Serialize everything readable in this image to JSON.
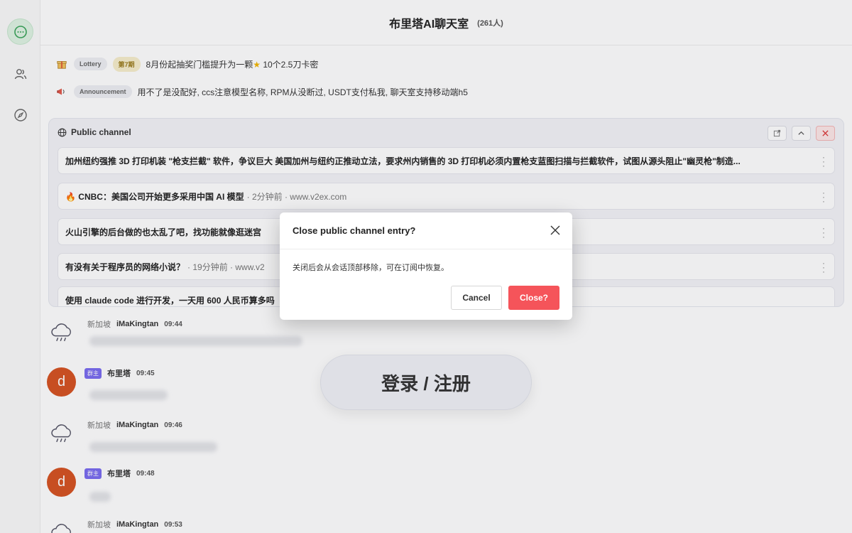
{
  "header": {
    "title": "布里塔AI聊天室",
    "member_count": "(261人)"
  },
  "sidebar": {
    "items": [
      {
        "icon": "chat-bubble-icon",
        "active": true
      },
      {
        "icon": "users-icon",
        "active": false
      },
      {
        "icon": "compass-icon",
        "active": false
      }
    ]
  },
  "notices": {
    "lottery": {
      "icon": "gift-icon",
      "tag": "Lottery",
      "period": "第7期",
      "text_before": "8月份起抽奖门槛提升为一颗",
      "text_after": "10个2.5刀卡密"
    },
    "announcement": {
      "icon": "megaphone-icon",
      "tag": "Announcement",
      "text": "用不了是没配好, ccs注意模型名称, RPM从没断过, USDT支付私我, 聊天室支持移动端h5"
    }
  },
  "public_channel": {
    "title": "Public channel",
    "items": [
      {
        "text": "加州纽约强推 3D 打印机装 \"枪支拦截\" 软件，争议巨大 美国加州与纽约正推动立法，要求州内销售的 3D 打印机必须内置枪支蓝图扫描与拦截软件，试图从源头阻止\"幽灵枪\"制造...",
        "meta": ""
      },
      {
        "text": "🔥 CNBC：美国公司开始更多采用中国 AI 模型",
        "meta": "· 2分钟前 · www.v2ex.com"
      },
      {
        "text": "火山引擎的后台做的也太乱了吧，找功能就像逛迷宫",
        "meta": ""
      },
      {
        "text": "有没有关于程序员的网络小说？",
        "meta": "· 19分钟前 · www.v2"
      },
      {
        "text": "使用 claude code 进行开发，一天用 600 人民币算多吗",
        "meta": ""
      }
    ]
  },
  "messages": [
    {
      "location": "新加坡",
      "username": "iMaKingtan",
      "time": "09:44",
      "avatar": "cloud-rain-icon",
      "role": ""
    },
    {
      "location": "",
      "username": "布里塔",
      "time": "09:45",
      "avatar": "d",
      "role": "群主"
    },
    {
      "location": "新加坡",
      "username": "iMaKingtan",
      "time": "09:46",
      "avatar": "cloud-rain-icon",
      "role": ""
    },
    {
      "location": "",
      "username": "布里塔",
      "time": "09:48",
      "avatar": "d",
      "role": "群主"
    },
    {
      "location": "新加坡",
      "username": "iMaKingtan",
      "time": "09:53",
      "avatar": "cloud-rain-icon",
      "role": ""
    }
  ],
  "login_button": "登录 / 注册",
  "dialog": {
    "title": "Close public channel entry?",
    "body": "关闭后会从会话顶部移除，可在订阅中恢复。",
    "cancel_label": "Cancel",
    "confirm_label": "Close?"
  },
  "colors": {
    "accent_green": "#dff3e3",
    "danger": "#f5545a",
    "role_badge": "#7a6cf0",
    "avatar_d": "#d65322"
  }
}
